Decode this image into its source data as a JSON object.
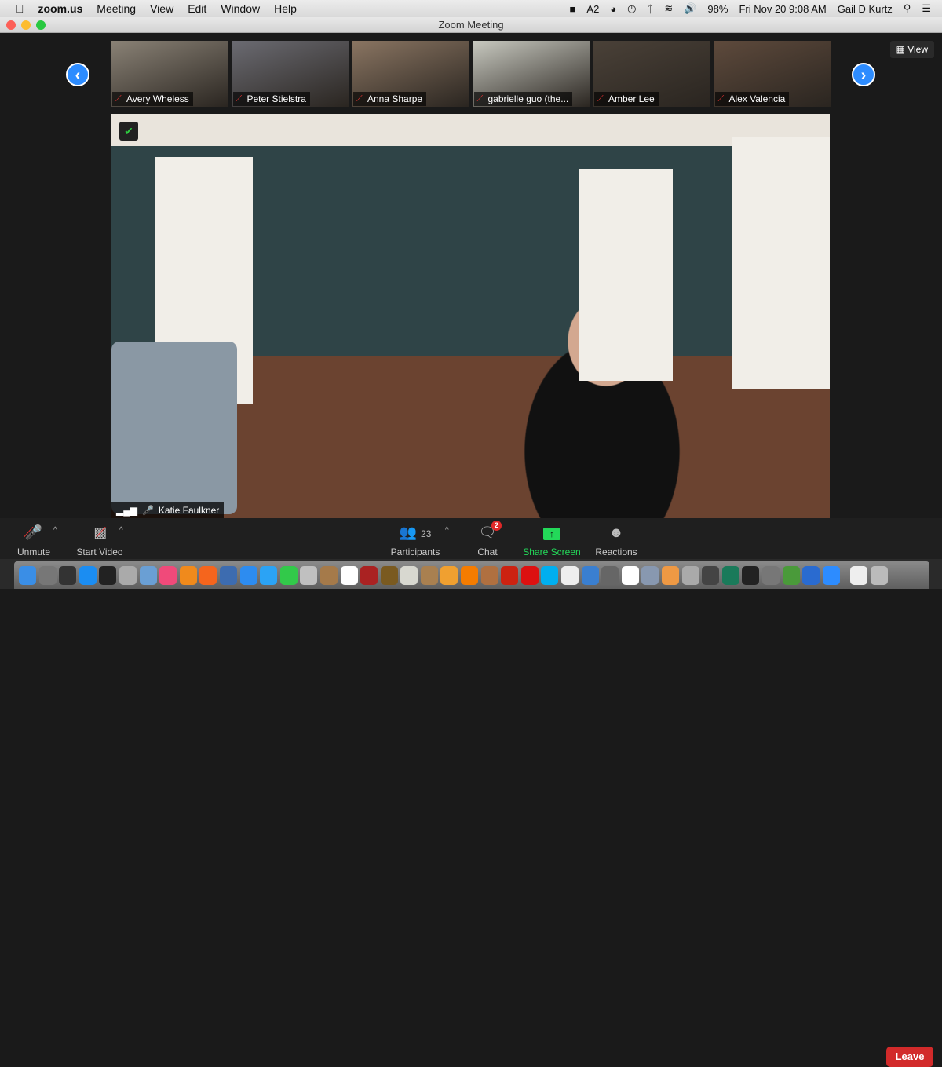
{
  "menubar": {
    "app": "zoom.us",
    "items": [
      "Meeting",
      "View",
      "Edit",
      "Window",
      "Help"
    ],
    "status": {
      "adobe_count": "2",
      "battery": "98%",
      "datetime": "Fri Nov 20  9:08 AM",
      "user": "Gail D Kurtz"
    }
  },
  "window": {
    "title": "Zoom Meeting"
  },
  "gallery": {
    "view_label": "View",
    "participants": [
      {
        "name": "Avery Wheless",
        "color": "#8a8276"
      },
      {
        "name": "Peter Stielstra",
        "color": "#6b6b72"
      },
      {
        "name": "Anna Sharpe",
        "color": "#8a7562"
      },
      {
        "name": "gabrielle guo (the...",
        "color": "#c8c9c0"
      },
      {
        "name": "Amber Lee",
        "color": "#4a4138"
      },
      {
        "name": "Alex Valencia",
        "color": "#5e4a3c"
      }
    ]
  },
  "main_video": {
    "speaker": "Katie Faulkner"
  },
  "toolbar": {
    "unmute": "Unmute",
    "start_video": "Start Video",
    "participants": "Participants",
    "participant_count": "23",
    "chat": "Chat",
    "chat_badge": "2",
    "share_screen": "Share Screen",
    "reactions": "Reactions",
    "leave": "Leave",
    "share_color": "#23d959",
    "leave_color": "#d22a2a"
  },
  "dock": {
    "icons": [
      "finder",
      "launchpad",
      "mission-control",
      "app-store",
      "dashboard",
      "system-info",
      "preview",
      "itunes",
      "ibooks",
      "firefox",
      "pages",
      "safari",
      "messages",
      "facetime",
      "word",
      "scroll",
      "chrome",
      "photo-booth",
      "jester",
      "stickies",
      "notes",
      "photos",
      "vlc",
      "guitar",
      "quicken",
      "acrobat",
      "skype",
      "textedit",
      "pen",
      "calculator",
      "calendar",
      "preview-2",
      "picasa",
      "pdf-tool",
      "star",
      "time-machine",
      "activity-monitor",
      "system-preferences",
      "excel",
      "onedrive",
      "zoom",
      "document",
      "trash"
    ]
  }
}
